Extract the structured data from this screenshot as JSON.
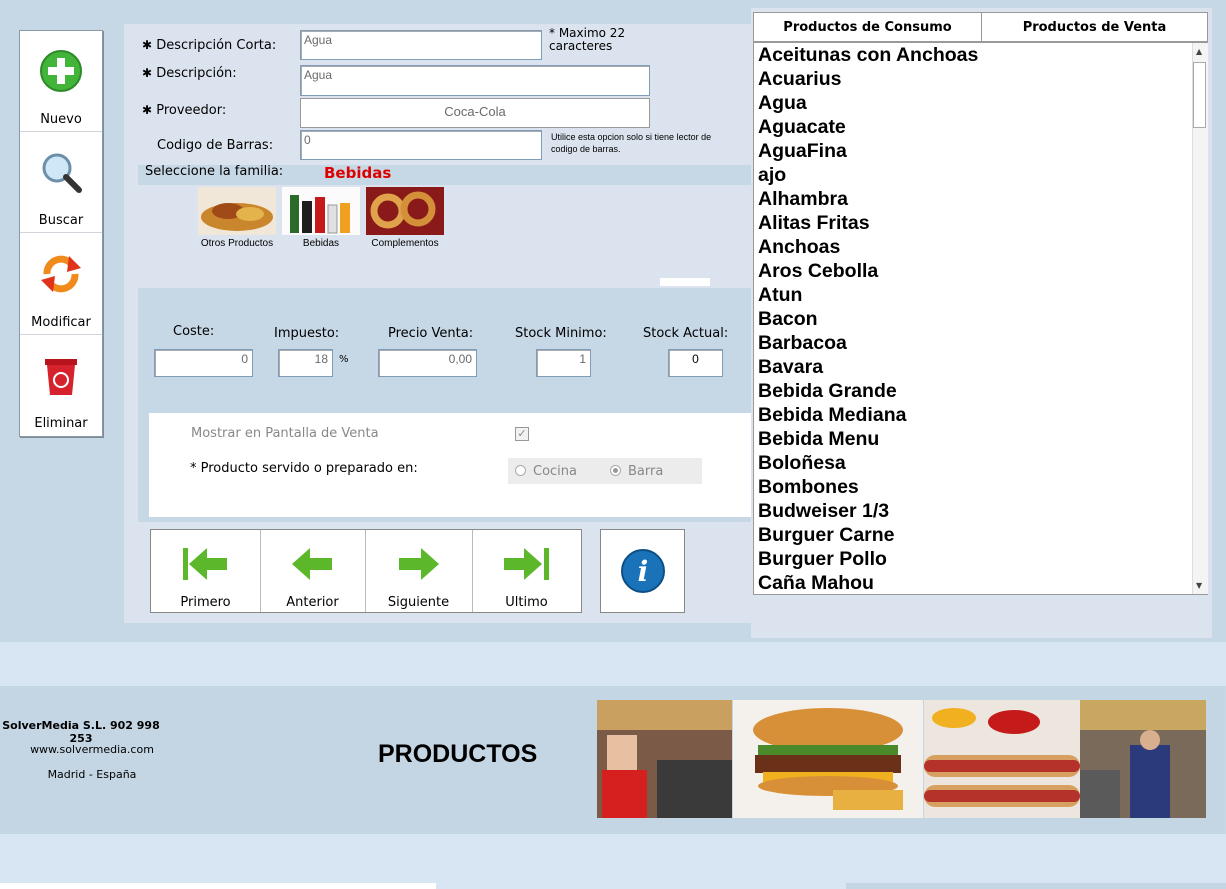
{
  "toolbar": {
    "new_label": "Nuevo",
    "search_label": "Buscar",
    "modify_label": "Modificar",
    "delete_label": "Eliminar"
  },
  "form": {
    "short_desc_label": "Descripción Corta:",
    "short_desc_value": "Agua",
    "short_desc_hint": "* Maximo 22 caracteres",
    "desc_label": "Descripción:",
    "desc_value": "Agua",
    "supplier_label": "Proveedor:",
    "supplier_value": "Coca-Cola",
    "barcode_label": "Codigo de Barras:",
    "barcode_value": "0",
    "barcode_hint": "Utilice esta opcion solo si tiene lector de codigo de barras.",
    "family_label": "Seleccione la familia:",
    "family_selected": "Bebidas",
    "families": [
      {
        "label": "Otros Productos"
      },
      {
        "label": "Bebidas"
      },
      {
        "label": "Complementos"
      }
    ],
    "cost_label": "Coste:",
    "cost_value": "0",
    "tax_label": "Impuesto:",
    "tax_value": "18",
    "tax_unit": "%",
    "price_label": "Precio Venta:",
    "price_value": "0,00",
    "stock_min_label": "Stock Minimo:",
    "stock_min_value": "1",
    "stock_cur_label": "Stock Actual:",
    "stock_cur_value": "0",
    "show_sale_label": "Mostrar en Pantalla de Venta",
    "show_sale_checked": true,
    "served_label": "* Producto servido o preparado en:",
    "served_options": [
      "Cocina",
      "Barra"
    ],
    "served_selected": "Barra"
  },
  "nav": {
    "first": "Primero",
    "prev": "Anterior",
    "next": "Siguiente",
    "last": "Ultimo"
  },
  "tabs": [
    "Productos de Consumo",
    "Productos de Venta"
  ],
  "products": [
    "Aceitunas con Anchoas",
    "Acuarius",
    "Agua",
    "Aguacate",
    "AguaFina",
    "ajo",
    "Alhambra",
    "Alitas Fritas",
    "Anchoas",
    "Aros Cebolla",
    "Atun",
    "Bacon",
    "Barbacoa",
    "Bavara",
    "Bebida Grande",
    "Bebida Mediana",
    "Bebida Menu",
    "Boloñesa",
    "Bombones",
    "Budweiser 1/3",
    "Burguer Carne",
    "Burguer Pollo",
    "Caña Mahou"
  ],
  "footer": {
    "company": "SolverMedia S.L. 902 998 253",
    "website": "www.solvermedia.com",
    "location": "Madrid - España",
    "title": "PRODUCTOS"
  },
  "colors": {
    "accent_red": "#dd0000",
    "green_arrow": "#5cb82a",
    "info_blue": "#1a73b8"
  }
}
